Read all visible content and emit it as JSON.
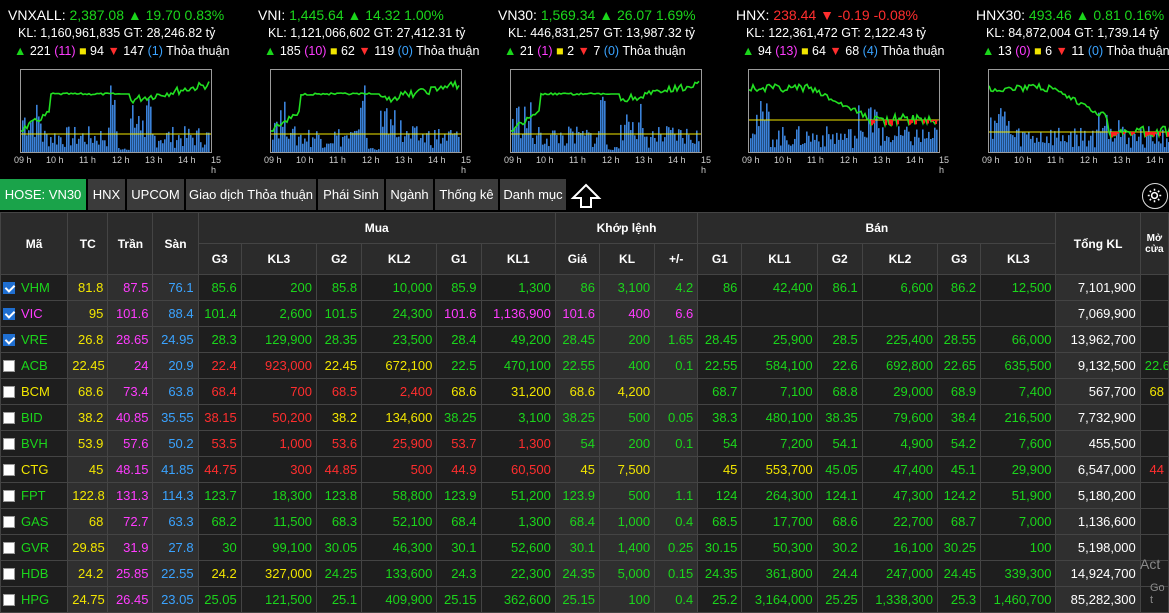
{
  "indices": [
    {
      "name": "VNXALL:",
      "value": "2,387.08",
      "change": "▲ 19.70 0.83%",
      "change_color": "g",
      "kl": "KL: 1,160,961,835 GT: 28,246.82 tỷ",
      "up": "221",
      "ceil": "(11)",
      "ref": "94",
      "down": "147",
      "floor": "(1)",
      "deal": "Thỏa thuận"
    },
    {
      "name": "VNI:",
      "value": "1,445.64",
      "change": "▲ 14.32 1.00%",
      "change_color": "g",
      "kl": "KL: 1,121,066,602 GT: 27,412.31 tỷ",
      "up": "185",
      "ceil": "(10)",
      "ref": "62",
      "down": "119",
      "floor": "(0)",
      "deal": "Thỏa thuận"
    },
    {
      "name": "VN30:",
      "value": "1,569.34",
      "change": "▲ 26.07 1.69%",
      "change_color": "g",
      "kl": "KL: 446,831,257 GT: 13,987.32 tỷ",
      "up": "21",
      "ceil": "(1)",
      "ref": "2",
      "down": "7",
      "floor": "(0)",
      "deal": "Thỏa thuận"
    },
    {
      "name": "HNX:",
      "value": "238.44",
      "change": "▼ -0.19 -0.08%",
      "change_color": "r",
      "kl": "KL: 122,361,472 GT: 2,122.43 tỷ",
      "up": "94",
      "ceil": "(13)",
      "ref": "64",
      "down": "68",
      "floor": "(4)",
      "deal": "Thỏa thuận"
    },
    {
      "name": "HNX30:",
      "value": "493.46",
      "change": "▲ 0.81 0.16%",
      "change_color": "g",
      "kl": "KL: 84,872,004 GT: 1,739.14 tỷ",
      "up": "13",
      "ceil": "(0)",
      "ref": "6",
      "down": "11",
      "floor": "(0)",
      "deal": "Thỏa thuận"
    }
  ],
  "hours": [
    "09 h",
    "10 h",
    "11 h",
    "12 h",
    "13 h",
    "14 h",
    "15 h"
  ],
  "tabs": [
    "HOSE: VN30",
    "HNX",
    "UPCOM",
    "Giao dịch Thỏa thuận",
    "Phái Sinh",
    "Ngành",
    "Thống kê",
    "Danh mục"
  ],
  "headers": {
    "ma": "Mã",
    "tc": "TC",
    "tran": "Trần",
    "san": "Sàn",
    "mua": "Mua",
    "khop": "Khớp lệnh",
    "ban": "Bán",
    "tongkl": "Tổng KL",
    "mo": "Mở cửa",
    "g3": "G3",
    "kl3": "KL3",
    "g2": "G2",
    "kl2": "KL2",
    "g1": "G1",
    "kl1": "KL1",
    "gia": "Giá",
    "kl": "KL",
    "pm": "+/-"
  },
  "rows": [
    {
      "sym": "VHM",
      "checked": true,
      "c": "g",
      "tc": "81.8",
      "tran": "87.5",
      "san": "76.1",
      "b3": "85.6",
      "bk3": "200",
      "b3c": "g",
      "b2": "85.8",
      "bk2": "10,000",
      "b2c": "g",
      "b1": "85.9",
      "bk1": "1,300",
      "b1c": "g",
      "p": "86",
      "v": "3,100",
      "d": "4.2",
      "pc": "g",
      "s1": "86",
      "sk1": "42,400",
      "s1c": "g",
      "s2": "86.1",
      "sk2": "6,600",
      "s2c": "g",
      "s3": "86.2",
      "sk3": "12,500",
      "s3c": "g",
      "tot": "7,101,900"
    },
    {
      "sym": "VIC",
      "checked": true,
      "c": "m",
      "tc": "95",
      "tran": "101.6",
      "san": "88.4",
      "b3": "101.4",
      "bk3": "2,600",
      "b3c": "g",
      "b2": "101.5",
      "bk2": "24,300",
      "b2c": "g",
      "b1": "101.6",
      "bk1": "1,136,900",
      "b1c": "m",
      "p": "101.6",
      "v": "400",
      "d": "6.6",
      "pc": "m",
      "s1": "",
      "sk1": "",
      "s1c": "g",
      "s2": "",
      "sk2": "",
      "s2c": "g",
      "s3": "",
      "sk3": "",
      "s3c": "g",
      "tot": "7,069,900"
    },
    {
      "sym": "VRE",
      "checked": true,
      "c": "g",
      "tc": "26.8",
      "tran": "28.65",
      "san": "24.95",
      "b3": "28.3",
      "bk3": "129,900",
      "b3c": "g",
      "b2": "28.35",
      "bk2": "23,500",
      "b2c": "g",
      "b1": "28.4",
      "bk1": "49,200",
      "b1c": "g",
      "p": "28.45",
      "v": "200",
      "d": "1.65",
      "pc": "g",
      "s1": "28.45",
      "sk1": "25,900",
      "s1c": "g",
      "s2": "28.5",
      "sk2": "225,400",
      "s2c": "g",
      "s3": "28.55",
      "sk3": "66,000",
      "s3c": "g",
      "tot": "13,962,700"
    },
    {
      "sym": "ACB",
      "checked": false,
      "c": "g",
      "tc": "22.45",
      "tran": "24",
      "san": "20.9",
      "b3": "22.4",
      "bk3": "923,000",
      "b3c": "r",
      "b2": "22.45",
      "bk2": "672,100",
      "b2c": "y",
      "b1": "22.5",
      "bk1": "470,100",
      "b1c": "g",
      "p": "22.55",
      "v": "400",
      "d": "0.1",
      "pc": "g",
      "s1": "22.55",
      "sk1": "584,100",
      "s1c": "g",
      "s2": "22.6",
      "sk2": "692,800",
      "s2c": "g",
      "s3": "22.65",
      "sk3": "635,500",
      "s3c": "g",
      "tot": "9,132,500"
    },
    {
      "sym": "BCM",
      "checked": false,
      "c": "y",
      "tc": "68.6",
      "tran": "73.4",
      "san": "63.8",
      "b3": "68.4",
      "bk3": "700",
      "b3c": "r",
      "b2": "68.5",
      "bk2": "2,400",
      "b2c": "r",
      "b1": "68.6",
      "bk1": "31,200",
      "b1c": "y",
      "p": "68.6",
      "v": "4,200",
      "d": "",
      "pc": "y",
      "s1": "68.7",
      "sk1": "7,100",
      "s1c": "g",
      "s2": "68.8",
      "sk2": "29,000",
      "s2c": "g",
      "s3": "68.9",
      "sk3": "7,400",
      "s3c": "g",
      "tot": "567,700"
    },
    {
      "sym": "BID",
      "checked": false,
      "c": "g",
      "tc": "38.2",
      "tran": "40.85",
      "san": "35.55",
      "b3": "38.15",
      "bk3": "50,200",
      "b3c": "r",
      "b2": "38.2",
      "bk2": "134,600",
      "b2c": "y",
      "b1": "38.25",
      "bk1": "3,100",
      "b1c": "g",
      "p": "38.25",
      "v": "500",
      "d": "0.05",
      "pc": "g",
      "s1": "38.3",
      "sk1": "480,100",
      "s1c": "g",
      "s2": "38.35",
      "sk2": "79,600",
      "s2c": "g",
      "s3": "38.4",
      "sk3": "216,500",
      "s3c": "g",
      "tot": "7,732,900"
    },
    {
      "sym": "BVH",
      "checked": false,
      "c": "g",
      "tc": "53.9",
      "tran": "57.6",
      "san": "50.2",
      "b3": "53.5",
      "bk3": "1,000",
      "b3c": "r",
      "b2": "53.6",
      "bk2": "25,900",
      "b2c": "r",
      "b1": "53.7",
      "bk1": "1,300",
      "b1c": "r",
      "p": "54",
      "v": "200",
      "d": "0.1",
      "pc": "g",
      "s1": "54",
      "sk1": "7,200",
      "s1c": "g",
      "s2": "54.1",
      "sk2": "4,900",
      "s2c": "g",
      "s3": "54.2",
      "sk3": "7,600",
      "s3c": "g",
      "tot": "455,500"
    },
    {
      "sym": "CTG",
      "checked": false,
      "c": "y",
      "tc": "45",
      "tran": "48.15",
      "san": "41.85",
      "b3": "44.75",
      "bk3": "300",
      "b3c": "r",
      "b2": "44.85",
      "bk2": "500",
      "b2c": "r",
      "b1": "44.9",
      "bk1": "60,500",
      "b1c": "r",
      "p": "45",
      "v": "7,500",
      "d": "",
      "pc": "y",
      "s1": "45",
      "sk1": "553,700",
      "s1c": "y",
      "s2": "45.05",
      "sk2": "47,400",
      "s2c": "g",
      "s3": "45.1",
      "sk3": "29,900",
      "s3c": "g",
      "tot": "6,547,000"
    },
    {
      "sym": "FPT",
      "checked": false,
      "c": "g",
      "tc": "122.8",
      "tran": "131.3",
      "san": "114.3",
      "b3": "123.7",
      "bk3": "18,300",
      "b3c": "g",
      "b2": "123.8",
      "bk2": "58,800",
      "b2c": "g",
      "b1": "123.9",
      "bk1": "51,200",
      "b1c": "g",
      "p": "123.9",
      "v": "500",
      "d": "1.1",
      "pc": "g",
      "s1": "124",
      "sk1": "264,300",
      "s1c": "g",
      "s2": "124.1",
      "sk2": "47,300",
      "s2c": "g",
      "s3": "124.2",
      "sk3": "51,900",
      "s3c": "g",
      "tot": "5,180,200"
    },
    {
      "sym": "GAS",
      "checked": false,
      "c": "g",
      "tc": "68",
      "tran": "72.7",
      "san": "63.3",
      "b3": "68.2",
      "bk3": "11,500",
      "b3c": "g",
      "b2": "68.3",
      "bk2": "52,100",
      "b2c": "g",
      "b1": "68.4",
      "bk1": "1,300",
      "b1c": "g",
      "p": "68.4",
      "v": "1,000",
      "d": "0.4",
      "pc": "g",
      "s1": "68.5",
      "sk1": "17,700",
      "s1c": "g",
      "s2": "68.6",
      "sk2": "22,700",
      "s2c": "g",
      "s3": "68.7",
      "sk3": "7,000",
      "s3c": "g",
      "tot": "1,136,600"
    },
    {
      "sym": "GVR",
      "checked": false,
      "c": "g",
      "tc": "29.85",
      "tran": "31.9",
      "san": "27.8",
      "b3": "30",
      "bk3": "99,100",
      "b3c": "g",
      "b2": "30.05",
      "bk2": "46,300",
      "b2c": "g",
      "b1": "30.1",
      "bk1": "52,600",
      "b1c": "g",
      "p": "30.1",
      "v": "1,400",
      "d": "0.25",
      "pc": "g",
      "s1": "30.15",
      "sk1": "50,300",
      "s1c": "g",
      "s2": "30.2",
      "sk2": "16,100",
      "s2c": "g",
      "s3": "30.25",
      "sk3": "100",
      "s3c": "g",
      "tot": "5,198,000"
    },
    {
      "sym": "HDB",
      "checked": false,
      "c": "g",
      "tc": "24.2",
      "tran": "25.85",
      "san": "22.55",
      "b3": "24.2",
      "bk3": "327,000",
      "b3c": "y",
      "b2": "24.25",
      "bk2": "133,600",
      "b2c": "g",
      "b1": "24.3",
      "bk1": "22,300",
      "b1c": "g",
      "p": "24.35",
      "v": "5,000",
      "d": "0.15",
      "pc": "g",
      "s1": "24.35",
      "sk1": "361,800",
      "s1c": "g",
      "s2": "24.4",
      "sk2": "247,000",
      "s2c": "g",
      "s3": "24.45",
      "sk3": "339,300",
      "s3c": "g",
      "tot": "14,924,700"
    },
    {
      "sym": "HPG",
      "checked": false,
      "c": "g",
      "tc": "24.75",
      "tran": "26.45",
      "san": "23.05",
      "b3": "25.05",
      "bk3": "121,500",
      "b3c": "g",
      "b2": "25.1",
      "bk2": "409,900",
      "b2c": "g",
      "b1": "25.15",
      "bk1": "362,600",
      "b1c": "g",
      "p": "25.15",
      "v": "100",
      "d": "0.4",
      "pc": "g",
      "s1": "25.2",
      "sk1": "3,164,000",
      "s1c": "g",
      "s2": "25.25",
      "sk2": "1,338,300",
      "s2c": "g",
      "s3": "25.3",
      "sk3": "1,460,700",
      "s3c": "g",
      "tot": "85,282,300"
    }
  ],
  "open_col": [
    "",
    "",
    "",
    "22.6",
    "68",
    "",
    "",
    "44",
    "",
    "",
    "",
    "",
    "",
    ""
  ],
  "watermark": "Act",
  "watermark2": "Go t"
}
